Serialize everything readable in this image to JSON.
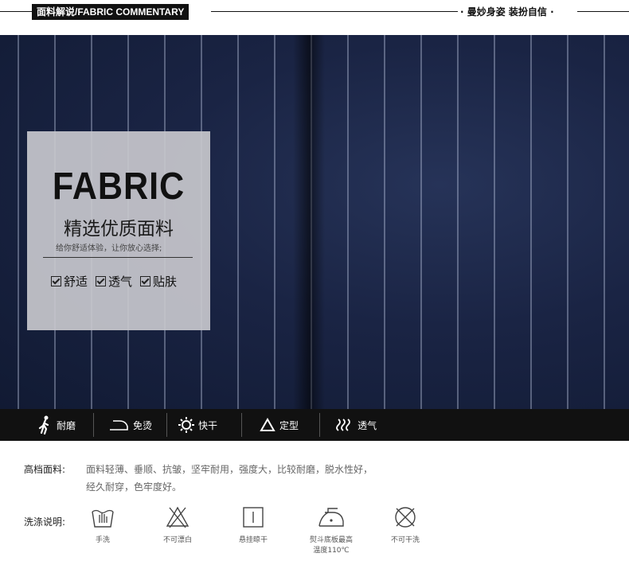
{
  "header": {
    "badge": "面料解说/FABRIC COMMENTARY",
    "slogan": "· 曼妙身姿 装扮自信 ·"
  },
  "card": {
    "title": "FABRIC",
    "subtitle": "精选优质面料",
    "desc": "给你舒适体验，让你放心选择;",
    "checks": [
      "舒适",
      "透气",
      "贴肤"
    ]
  },
  "features": [
    {
      "label": "耐磨",
      "icon": "walking-person-icon"
    },
    {
      "label": "免烫",
      "icon": "iron-icon"
    },
    {
      "label": "快干",
      "icon": "sun-icon"
    },
    {
      "label": "定型",
      "icon": "triangle-icon"
    },
    {
      "label": "透气",
      "icon": "wave-icon"
    }
  ],
  "details": {
    "material_label": "高档面料:",
    "material_line1": "面料轻薄、垂顺、抗皱，坚牢耐用，强度大，比较耐磨，脱水性好，",
    "material_line2": "经久耐穿，色牢度好。",
    "wash_label": "洗涤说明:"
  },
  "care": [
    {
      "label": "手洗",
      "icon": "hand-wash-icon"
    },
    {
      "label": "不可漂白",
      "icon": "no-bleach-icon"
    },
    {
      "label": "悬挂晾干",
      "icon": "hang-dry-icon"
    },
    {
      "label": "熨斗底板最高",
      "label2": "温度110℃",
      "icon": "iron-temperature-icon"
    },
    {
      "label": "不可干洗",
      "icon": "no-dry-clean-icon"
    }
  ],
  "colors": {
    "fabric_navy": "#1a2444",
    "bar_black": "#111111",
    "card_gray": "#c8c8cd"
  }
}
